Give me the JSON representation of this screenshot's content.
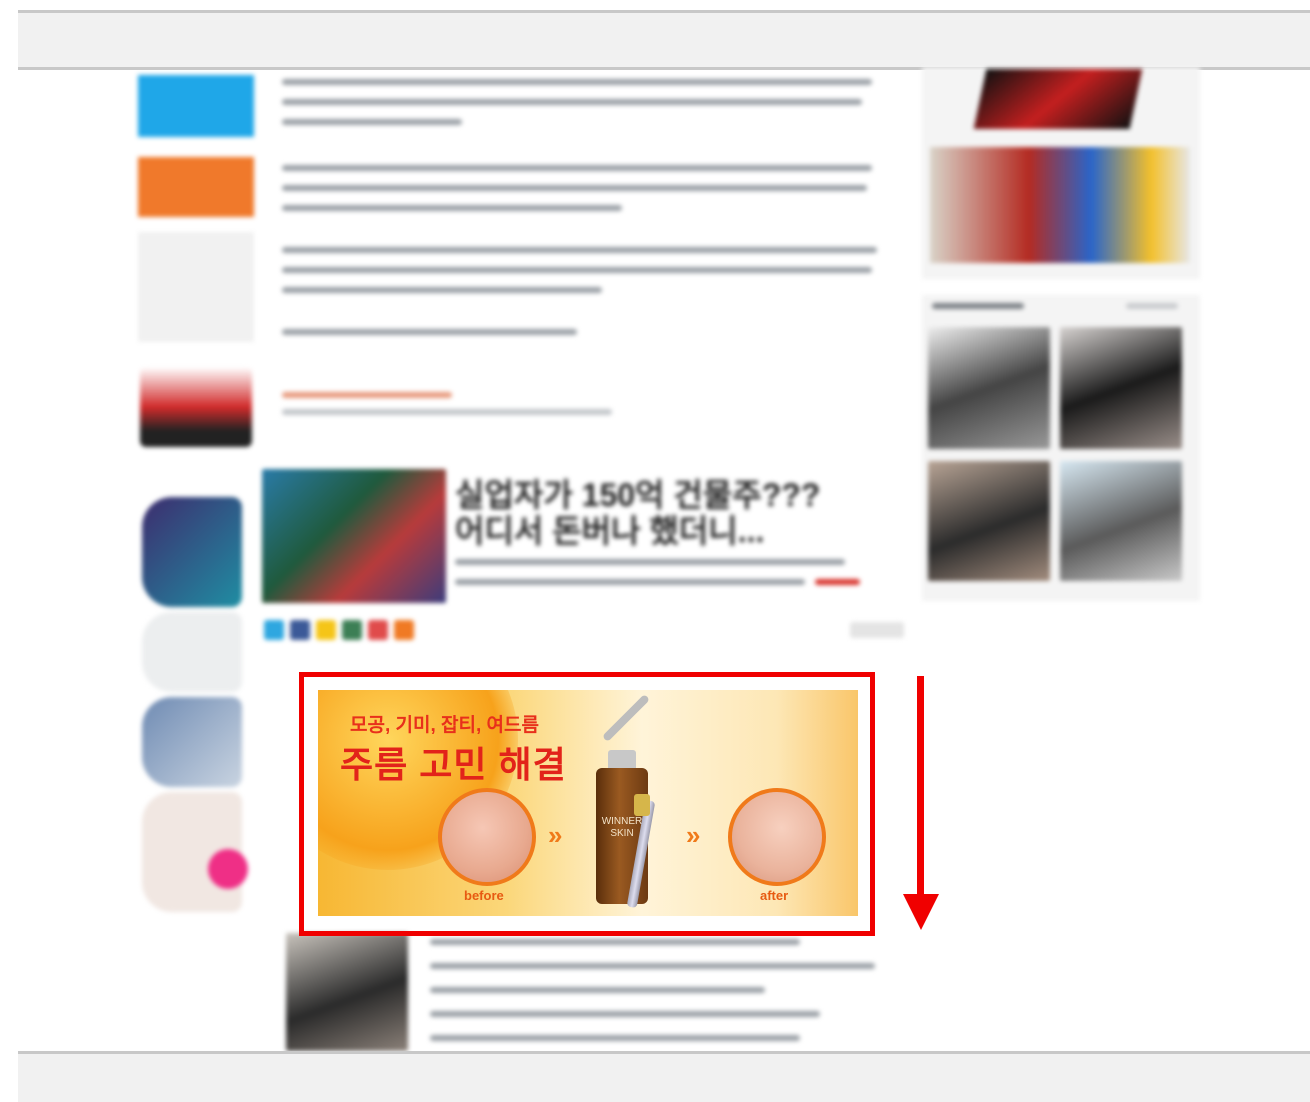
{
  "ad": {
    "line1": "모공, 기미, 잡티, 여드름",
    "line2": "주름 고민 해결",
    "before_label": "before",
    "after_label": "after",
    "bottle_label": "WINNER SKIN",
    "highlight_color": "#f00000",
    "accent_color": "#e2231a"
  },
  "article": {
    "headline": "실업자가 150억 건물주???",
    "headline2": "어디서 돈버나 했더니..."
  },
  "arrow": {
    "icon": "arrow-down-icon",
    "color": "#f00000"
  }
}
